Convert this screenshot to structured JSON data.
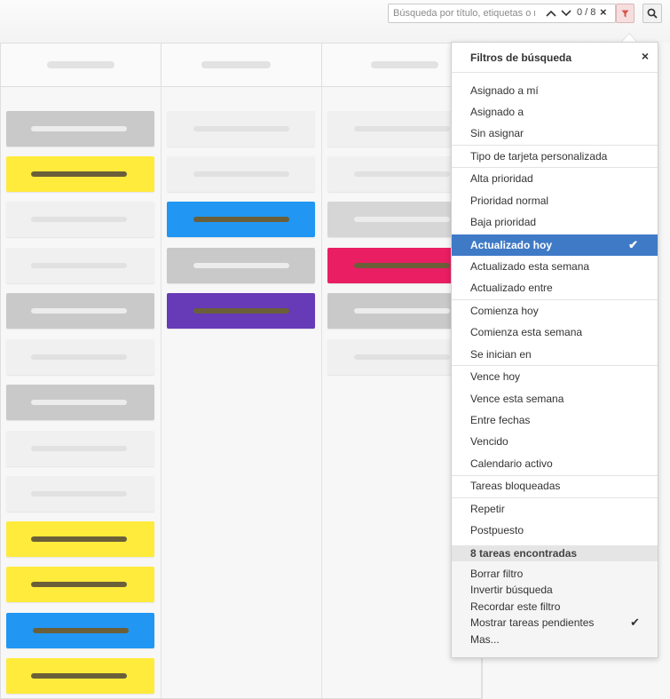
{
  "search": {
    "placeholder": "Búsqueda por título, etiquetas o nota",
    "counter": "0 / 8",
    "clear": "×"
  },
  "icons": {
    "prev": "chevron-up-icon",
    "next": "chevron-down-icon",
    "filter": "funnel-icon",
    "search": "magnifier-icon"
  },
  "colors": {
    "accent": "#3f7ac6",
    "yellow": "#ffeb3b",
    "blue": "#2196f3",
    "purple": "#673ab7",
    "pink": "#e91e63",
    "filter_active": "#d9534f"
  },
  "dropdown": {
    "title": "Filtros de búsqueda",
    "close": "×",
    "items": [
      "Asignado a mí",
      "Asignado a",
      "Sin asignar",
      "Tipo de tarjeta personalizada",
      "Alta prioridad",
      "Prioridad normal",
      "Baja prioridad",
      "Actualizado hoy",
      "Actualizado esta semana",
      "Actualizado entre",
      "Comienza hoy",
      "Comienza esta semana",
      "Se inician en",
      "Vence hoy",
      "Vence esta semana",
      "Entre fechas",
      "Vencido",
      "Calendario activo",
      "Tareas bloqueadas",
      "Repetir",
      "Postpuesto"
    ],
    "active_item": "Actualizado hoy",
    "check": "✔",
    "found_label": "8 tareas encontradas",
    "actions": [
      "Borrar filtro",
      "Invertir búsqueda",
      "Recordar este filtro",
      "Mostrar tareas pendientes",
      "Mas..."
    ],
    "checked_action": "Mostrar tareas pendientes"
  }
}
